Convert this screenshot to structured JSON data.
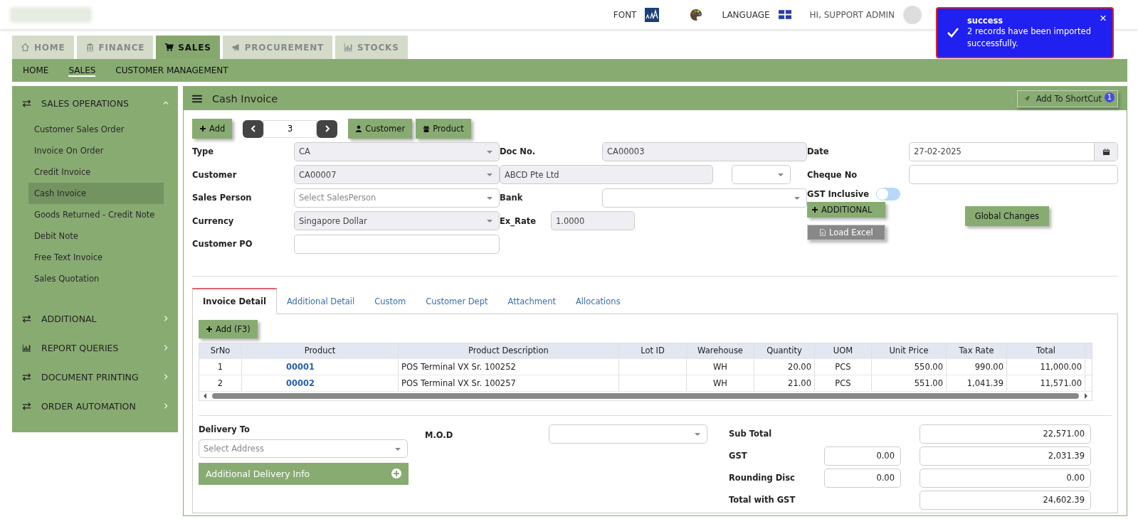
{
  "header": {
    "font_label": "FONT",
    "language_label": "LANGUAGE",
    "user_label": "HI, SUPPORT ADMIN"
  },
  "toast": {
    "title": "success",
    "message": "2 records have been imported successfully.",
    "close": "×"
  },
  "module_tabs": [
    {
      "label": "HOME",
      "selected": false
    },
    {
      "label": "FINANCE",
      "selected": false
    },
    {
      "label": "SALES",
      "selected": true
    },
    {
      "label": "PROCUREMENT",
      "selected": false
    },
    {
      "label": "STOCKS",
      "selected": false
    }
  ],
  "subnav": [
    {
      "label": "HOME",
      "selected": false
    },
    {
      "label": "SALES",
      "selected": true
    },
    {
      "label": "CUSTOMER MANAGEMENT",
      "selected": false
    }
  ],
  "sidebar": [
    {
      "title": "SALES OPERATIONS",
      "expanded": true,
      "items": [
        {
          "label": "Customer Sales Order",
          "selected": false
        },
        {
          "label": "Invoice On Order",
          "selected": false
        },
        {
          "label": "Credit Invoice",
          "selected": false
        },
        {
          "label": "Cash Invoice",
          "selected": true
        },
        {
          "label": "Goods Returned - Credit Note",
          "selected": false
        },
        {
          "label": "Debit Note",
          "selected": false
        },
        {
          "label": "Free Text Invoice",
          "selected": false
        },
        {
          "label": "Sales Quotation",
          "selected": false
        }
      ]
    },
    {
      "title": "ADDITIONAL",
      "expanded": false
    },
    {
      "title": "REPORT QUERIES",
      "expanded": false
    },
    {
      "title": "DOCUMENT PRINTING",
      "expanded": false
    },
    {
      "title": "ORDER AUTOMATION",
      "expanded": false
    }
  ],
  "panel": {
    "title": "Cash Invoice",
    "shortcut_label": "Add To ShortCut",
    "shortcut_badge": "1"
  },
  "toolbar": {
    "add_label": "Add",
    "record": "3",
    "buttons": [
      {
        "label": "Customer"
      },
      {
        "label": "Product"
      }
    ]
  },
  "form_columns": [
    [
      {
        "label": "Type",
        "fields": [
          {
            "kind": "select",
            "value": "CA",
            "disabled": true
          }
        ]
      },
      {
        "label": "Customer",
        "fields": [
          {
            "kind": "select",
            "value": "CA00007",
            "disabled": true
          }
        ]
      },
      {
        "label": "Sales Person",
        "fields": [
          {
            "kind": "select",
            "placeholder": "Select SalesPerson",
            "disabled": false
          }
        ]
      },
      {
        "label": "Currency",
        "fields": [
          {
            "kind": "select",
            "value": "Singapore Dollar",
            "disabled": true
          }
        ]
      },
      {
        "label": "Customer PO",
        "fields": [
          {
            "kind": "input",
            "disabled": false
          }
        ]
      }
    ],
    [
      {
        "label": "Doc No.",
        "fields": [
          {
            "kind": "input",
            "value": "CA00003",
            "disabled": true
          }
        ]
      },
      {
        "fields": [
          {
            "kind": "input",
            "value": "ABCD Pte Ltd",
            "disabled": true
          },
          {
            "kind": "select",
            "disabled": false
          }
        ]
      },
      {
        "label": "Bank",
        "fields": [
          {
            "kind": "select",
            "disabled": false
          }
        ]
      },
      {
        "label": "Ex_Rate",
        "fields": [
          {
            "kind": "input",
            "value": "1.0000",
            "disabled": true
          }
        ]
      }
    ],
    [
      {
        "label": "Date",
        "fields": [
          {
            "kind": "date",
            "value": "27-02-2025",
            "disabled": false
          }
        ]
      },
      {
        "label": "Cheque No",
        "fields": [
          {
            "kind": "input",
            "disabled": false
          }
        ]
      }
    ]
  ],
  "gst_inclusive": {
    "label": "GST Inclusive",
    "on": false
  },
  "additional_button": "ADDITIONAL",
  "load_excel_button": "Load Excel",
  "global_changes_button": "Global Changes",
  "detail_tabs": [
    {
      "label": "Invoice Detail",
      "selected": true
    },
    {
      "label": "Additional Detail",
      "selected": false
    },
    {
      "label": "Custom",
      "selected": false
    },
    {
      "label": "Customer Dept",
      "selected": false
    },
    {
      "label": "Attachment",
      "selected": false
    },
    {
      "label": "Allocations",
      "selected": false
    }
  ],
  "grid": {
    "add_label": "Add (F3)",
    "columns": [
      "SrNo",
      "Product",
      "Product Description",
      "Lot ID",
      "Warehouse",
      "Quantity",
      "UOM",
      "Unit Price",
      "Tax Rate",
      "Total"
    ],
    "rows": [
      [
        "1",
        "00001",
        "POS Terminal VX Sr. 100252",
        "",
        "WH",
        "20.00",
        "PCS",
        "550.00",
        "990.00",
        "11,000.00"
      ],
      [
        "2",
        "00002",
        "POS Terminal VX Sr. 100257",
        "",
        "WH",
        "21.00",
        "PCS",
        "551.00",
        "1,041.39",
        "11,571.00"
      ]
    ]
  },
  "delivery": {
    "label": "Delivery To",
    "placeholder": "Select Address",
    "info_label": "Additional Delivery Info"
  },
  "mod": {
    "label": "M.O.D"
  },
  "totals": [
    {
      "label": "Sub Total",
      "value": "22,571.00"
    },
    {
      "label": "GST",
      "tax": "0.00",
      "value": "2,031.39"
    },
    {
      "label": "Rounding Disc",
      "tax": "0.00",
      "value": "0.00"
    },
    {
      "label": "Total with GST",
      "value": "24,602.39"
    }
  ]
}
